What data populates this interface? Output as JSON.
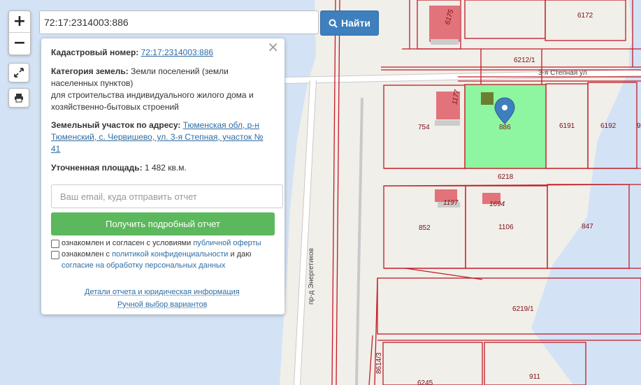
{
  "search": {
    "value": "72:17:2314003:886",
    "button_label": "Найти"
  },
  "controls": {
    "zoom_in": "+",
    "zoom_out": "−"
  },
  "panel": {
    "cadastral_label": "Кадастровый номер:",
    "cadastral_value": "72:17:2314003:886",
    "category_label": "Категория земель:",
    "category_value": "Земли поселений (земли населенных пунктов)",
    "usage": "для строительства индивидуального жилого дома и хозяйственно-бытовых строений",
    "address_label": "Земельный участок по адресу:",
    "address_value": "Тюменская обл, р-н Тюменский, с. Червишево, ул. 3-я Степная, участок № 41",
    "area_label": "Уточненная площадь:",
    "area_value": "1 482 кв.м.",
    "email_placeholder": "Ваш email, куда отправить отчет",
    "report_button": "Получить подробный отчет",
    "agree1_text": "ознакомлен и согласен с условиями",
    "agree1_link": "публичной оферты",
    "agree2_text": "ознакомлен с",
    "agree2_link1": "политикой конфиденциальности",
    "agree2_mid": "и даю",
    "agree2_link2": "согласие на обработку персональных данных",
    "details_link": "Детали отчета и юридическая информация",
    "manual_link": "Ручной выбор вариантов"
  },
  "map": {
    "selected_parcel": "886",
    "streets": {
      "stepnaya": "3-я Степная ул",
      "energetikov": "пр-д Энергетиков"
    },
    "parcels": {
      "p6172": "6172",
      "p6212_1": "6212/1",
      "p754": "754",
      "p6191": "6191",
      "p6192": "6192",
      "p9": "9",
      "p6218": "6218",
      "p852": "852",
      "p1106": "1106",
      "p847": "847",
      "p6219_1": "6219/1",
      "p911": "911",
      "p6245": "6245",
      "p8614_3": "8614/3"
    },
    "buildings": {
      "b6175": "6175",
      "b1177": "1177",
      "b1197": "1197",
      "b1694": "1694"
    }
  },
  "colors": {
    "selected_fill": "#8ef5a0",
    "parcel_line": "#c21a26",
    "water": "#cfe0f4",
    "building": "#e2737a",
    "button_blue": "#3e7fbe",
    "button_green": "#5cb85c"
  }
}
